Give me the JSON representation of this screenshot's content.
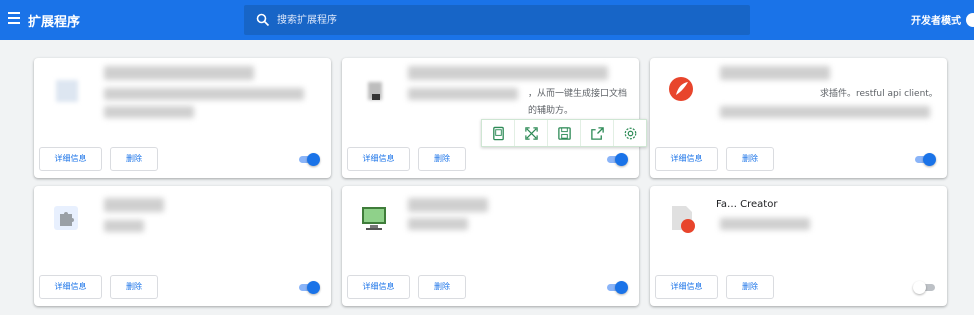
{
  "header": {
    "title": "扩展程序",
    "search_placeholder": "搜索扩展程序",
    "dev_mode_label": "开发者模式"
  },
  "buttons": {
    "details": "详细信息",
    "remove": "删除"
  },
  "cards": [
    {
      "name": "",
      "desc": "",
      "enabled": true
    },
    {
      "name": "",
      "desc": "，从而一键生成接口文档的辅助方。",
      "enabled": true
    },
    {
      "name": "",
      "desc": "求插件。restful api client。",
      "enabled": true
    },
    {
      "name": "",
      "desc": "",
      "enabled": true
    },
    {
      "name": "",
      "desc": "",
      "enabled": true
    },
    {
      "name": "Fa… Creator",
      "desc": "",
      "enabled": false
    }
  ],
  "floating_toolbar": {
    "icons": [
      "device-icon",
      "expand-icon",
      "save-icon",
      "share-icon",
      "settings-icon"
    ]
  },
  "colors": {
    "accent": "#1a73e8",
    "toolbar_icon": "#2e8b57"
  }
}
